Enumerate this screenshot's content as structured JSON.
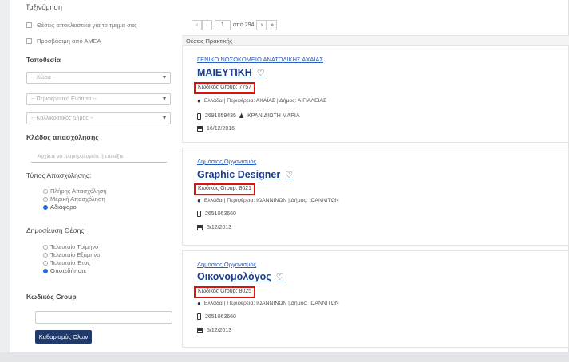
{
  "sidebar": {
    "partial_heading": "Ταξινόμηση",
    "checkbox_only_dept": "Θέσεις αποκλειστικά για το τμήμα σας",
    "checkbox_amea": "Προσβάσιμη από ΑΜΕΑ",
    "location_title": "Τοποθεσία",
    "country_select": "-- Χώρα --",
    "region_select": "-- Περιφερειακή Ενότητα --",
    "municipality_select": "-- Καλλικρατικός Δήμος --",
    "sector_title": "Κλάδος απασχόλησης",
    "sector_placeholder": "Αρχίστε να πληκτρολογείτε ή επιλέξτε",
    "employment_type_title": "Τύπος Απασχόλησης:",
    "employment_types": [
      "Πλήρης Απασχόληση",
      "Μερική Απασχόληση",
      "Αδιάφορο"
    ],
    "publication_title": "Δημοσίευση Θέσης:",
    "publication_options": [
      "Τελευταίο Τρίμηνο",
      "Τελευταίο Εξάμηνο",
      "Τελευταίο Έτος",
      "Οποτεδήποτε"
    ],
    "group_code_title": "Κωδικός Group",
    "clear_all_button": "Καθαρισμός Όλων"
  },
  "pager": {
    "first": "«",
    "prev": "‹",
    "page": "1",
    "of_text": "από 294",
    "next": "›",
    "last": "»"
  },
  "list_heading": "Θέσεις Πρακτικής",
  "jobs": [
    {
      "org": "ΓΕΝΙΚΟ ΝΟΣΟΚΟΜΕΙΟ ΑΝΑΤΟΛΙΚΗΣ ΑΧΑΪΑΣ",
      "title": "ΜΑΙΕΥΤΙΚΗ",
      "group_code": "Κωδικός Group: 7757",
      "location": "Ελλάδα | Περιφέρεια: ΑΧΑΪΑΣ | Δήμος: ΑΙΓΙΑΛΕΙΑΣ",
      "phone_contact": "2691059435",
      "contact_person": "ΚΡΑΝΙΔΙΩΤΗ ΜΑΡΙΑ",
      "date": "16/12/2016"
    },
    {
      "org": "Δημόσιος Οργανισμός",
      "title": "Graphic Designer",
      "group_code": "Κωδικός Group: 8021",
      "location": "Ελλάδα | Περιφέρεια: ΙΩΑΝΝΙΝΩΝ | Δήμος: ΙΩΑΝΝΙΤΩΝ",
      "phone_contact": "2651063660",
      "contact_person": "",
      "date": "5/12/2013"
    },
    {
      "org": "Δημόσιος Οργανισμός",
      "title": "Οικονομολόγος",
      "group_code": "Κωδικός Group: 8025",
      "location": "Ελλάδα | Περιφέρεια: ΙΩΑΝΝΙΝΩΝ | Δήμος: ΙΩΑΝΝΙΤΩΝ",
      "phone_contact": "2651063660",
      "contact_person": "",
      "date": "5/12/2013"
    }
  ],
  "colors": {
    "accent": "#1f3f8a",
    "highlight_box": "#e01010",
    "button_bg": "#1f3a6b"
  }
}
